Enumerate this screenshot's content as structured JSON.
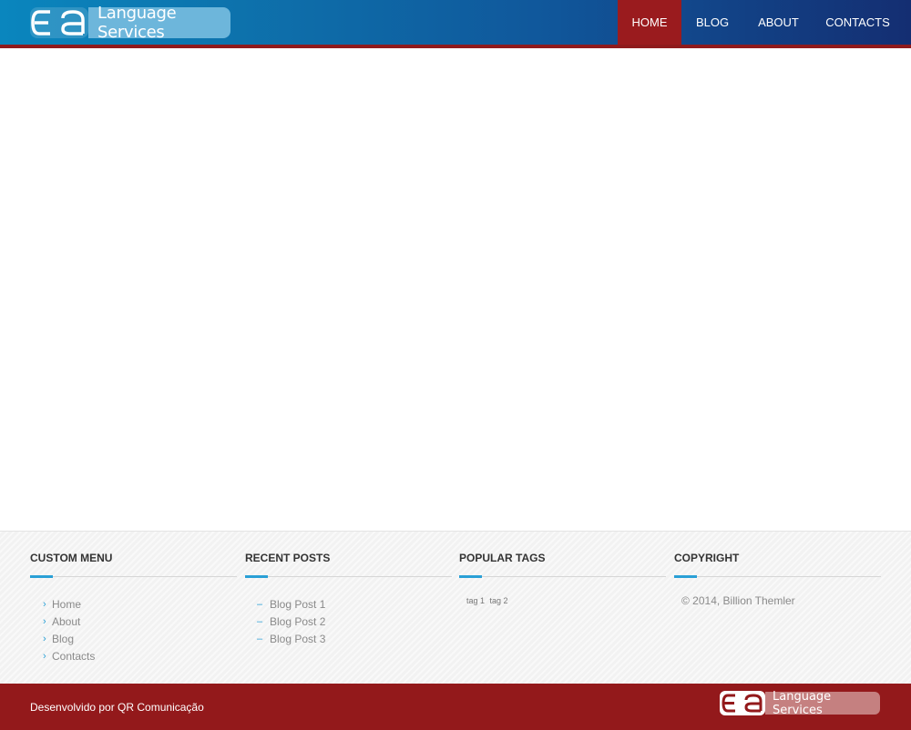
{
  "brand": {
    "logo_mark": "ea",
    "name": "Language Services"
  },
  "nav": {
    "items": [
      {
        "label": "HOME",
        "active": true
      },
      {
        "label": "BLOG",
        "active": false
      },
      {
        "label": "ABOUT",
        "active": false
      },
      {
        "label": "CONTACTS",
        "active": false
      }
    ]
  },
  "footer": {
    "custom_menu": {
      "title": "CUSTOM MENU",
      "items": [
        "Home",
        "About",
        "Blog",
        "Contacts"
      ]
    },
    "recent_posts": {
      "title": "RECENT POSTS",
      "items": [
        "Blog Post 1",
        "Blog Post 2",
        "Blog Post 3"
      ]
    },
    "popular_tags": {
      "title": "POPULAR TAGS",
      "tags": [
        "tag 1",
        "tag 2"
      ]
    },
    "copyright": {
      "title": "COPYRIGHT",
      "text": "© 2014, Billion Themler"
    }
  },
  "bottom_bar": {
    "credit": "Desenvolvido por QR Comunicação",
    "logo_name": "Language Services"
  },
  "colors": {
    "header_start": "#0a86be",
    "header_end": "#142e72",
    "accent_red": "#93191b",
    "accent_blue": "#2aa0d6"
  }
}
